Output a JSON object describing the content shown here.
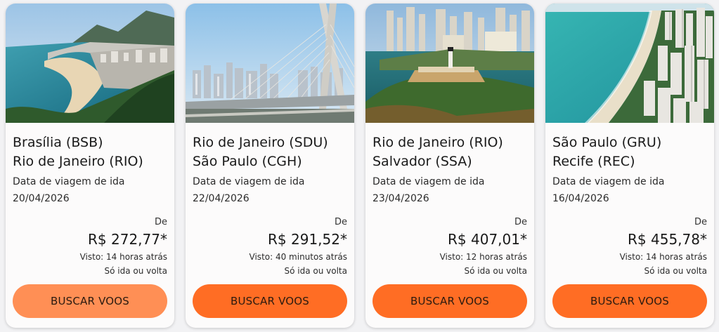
{
  "cards": [
    {
      "origin": "Brasília (BSB)",
      "destination": "Rio de Janeiro (RIO)",
      "date_label": "Data de viagem de ida",
      "date": "20/04/2026",
      "from_label": "De",
      "price": "R$ 272,77*",
      "seen": "Visto: 14 horas atrás",
      "trip_type": "Só ida ou volta",
      "button_label": "BUSCAR VOOS",
      "button_color": "#ff8f55"
    },
    {
      "origin": "Rio de Janeiro (SDU)",
      "destination": "São Paulo (CGH)",
      "date_label": "Data de viagem de ida",
      "date": "22/04/2026",
      "from_label": "De",
      "price": "R$ 291,52*",
      "seen": "Visto: 40 minutos atrás",
      "trip_type": "Só ida ou volta",
      "button_label": "BUSCAR VOOS",
      "button_color": "#ff6d24"
    },
    {
      "origin": "Rio de Janeiro (RIO)",
      "destination": "Salvador (SSA)",
      "date_label": "Data de viagem de ida",
      "date": "23/04/2026",
      "from_label": "De",
      "price": "R$ 407,01*",
      "seen": "Visto: 12 horas atrás",
      "trip_type": "Só ida ou volta",
      "button_label": "BUSCAR VOOS",
      "button_color": "#ff6d24"
    },
    {
      "origin": "São Paulo (GRU)",
      "destination": "Recife (REC)",
      "date_label": "Data de viagem de ida",
      "date": "16/04/2026",
      "from_label": "De",
      "price": "R$ 455,78*",
      "seen": "Visto: 14 horas atrás",
      "trip_type": "Só ida ou volta",
      "button_label": "BUSCAR VOOS",
      "button_color": "#ff6d24"
    }
  ]
}
